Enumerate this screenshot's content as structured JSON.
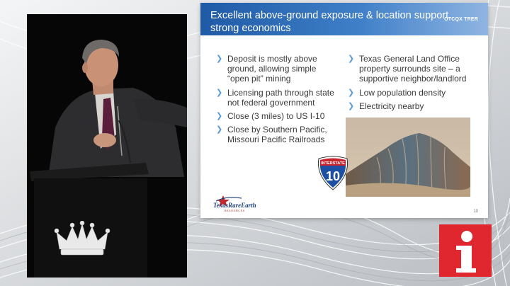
{
  "slide": {
    "title": "Excellent above-ground exposure & location support strong economics",
    "ticker": "OTCQX TRER",
    "bullets_left": [
      "Deposit is mostly above ground, allowing simple “open pit” mining",
      "Licensing path through state not federal government",
      "Close (3 miles) to US I-10",
      "Close by Southern Pacific, Missouri Pacific Railroads"
    ],
    "bullets_right": [
      "Texas General Land Office property surrounds site – a supportive neighbor/landlord",
      "Low population density",
      "Electricity nearby"
    ],
    "shield_top": "INTERSTATE",
    "shield_number": "10",
    "logo_text": "TexasRareEarth",
    "logo_sub": "RESOURCES",
    "page_number": "10"
  },
  "badge_letter": "i",
  "colors": {
    "header_blue": "#1f5aa6",
    "bullet_chevron": "#5a9bd6",
    "badge_red": "#e0262f"
  },
  "icons": [
    "chevron-bullet-icon",
    "interstate-shield-icon",
    "texas-star-logo-icon",
    "crown-icon",
    "info-i-icon"
  ]
}
